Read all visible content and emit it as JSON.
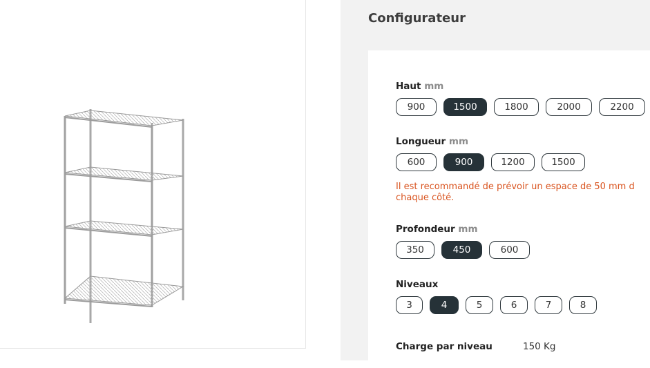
{
  "configurator": {
    "title": "Configurateur",
    "height": {
      "label": "Haut",
      "unit": "mm",
      "options": [
        "900",
        "1500",
        "1800",
        "2000",
        "2200"
      ],
      "selected": "1500"
    },
    "length": {
      "label": "Longueur",
      "unit": "mm",
      "options": [
        "600",
        "900",
        "1200",
        "1500"
      ],
      "selected": "900"
    },
    "warning": {
      "line1": "Il est recommandé de prévoir un espace de 50 mm d",
      "line2": "chaque côté."
    },
    "depth": {
      "label": "Profondeur",
      "unit": "mm",
      "options": [
        "350",
        "450",
        "600"
      ],
      "selected": "450"
    },
    "levels": {
      "label": "Niveaux",
      "options": [
        "3",
        "4",
        "5",
        "6",
        "7",
        "8"
      ],
      "selected": "4"
    },
    "charge": {
      "label": "Charge par niveau",
      "value": "150 Kg"
    }
  },
  "colors": {
    "selected_bg": "#263238",
    "warning": "#d9531e",
    "panel_bg": "#f2f2f2"
  }
}
